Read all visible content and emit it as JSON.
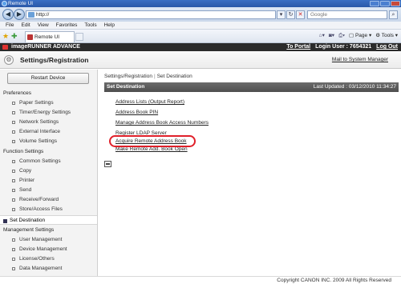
{
  "window": {
    "title": "Remote UI"
  },
  "browser": {
    "url": "http://",
    "search_placeholder": "Google",
    "menu": [
      "File",
      "Edit",
      "View",
      "Favorites",
      "Tools",
      "Help"
    ],
    "tab_label": "Remote UI",
    "command_bar": {
      "page": "Page",
      "tools": "Tools"
    }
  },
  "app": {
    "product": "imageRUNNER ADVANCE",
    "to_portal": "To Portal",
    "login_user": "Login User : 7654321",
    "logout": "Log Out",
    "page_title": "Settings/Registration",
    "mail_link": "Mail to System Manager"
  },
  "sidebar": {
    "restart_label": "Restart Device",
    "preferences_heading": "Preferences",
    "preferences": [
      "Paper Settings",
      "Timer/Energy Settings",
      "Network Settings",
      "External Interface",
      "Volume Settings"
    ],
    "function_heading": "Function Settings",
    "functions": [
      "Common Settings",
      "Copy",
      "Printer",
      "Send",
      "Receive/Forward",
      "Store/Access Files"
    ],
    "selected_item": "Set Destination",
    "management_heading": "Management Settings",
    "management": [
      "User Management",
      "Device Management",
      "License/Others",
      "Data Management"
    ]
  },
  "main": {
    "breadcrumb": [
      "Settings/Registration",
      "Set Destination"
    ],
    "section_title": "Set Destination",
    "last_updated": "Last Updated : 03/12/2010 11:34:27",
    "links": [
      "Address Lists (Output Report)",
      "Address Book PIN",
      "Manage Address Book Access Numbers",
      "Register LDAP Server",
      "Acquire Remote Address Book",
      "Make Remote Add. Book Open"
    ]
  },
  "footer": {
    "copyright": "Copyright CANON INC. 2009 All Rights Reserved"
  },
  "colors": {
    "highlight": "#e0202a",
    "header_bg": "#2b2b2b",
    "band_bg": "#5a5a5a"
  }
}
